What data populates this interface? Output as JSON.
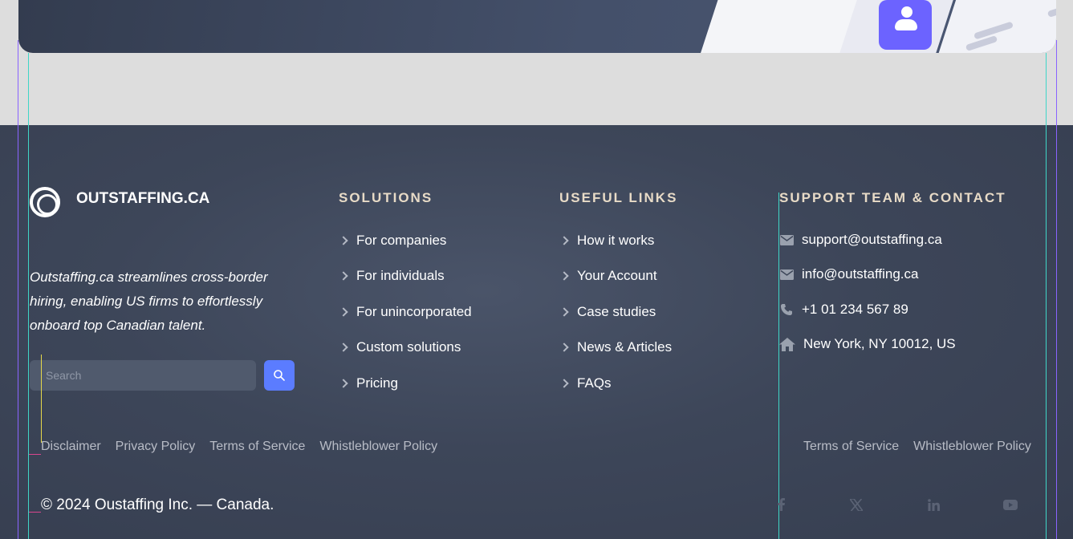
{
  "brand": {
    "name": "OUTSTAFFING.CA"
  },
  "tagline": "Outstaffing.ca streamlines cross-border hiring, enabling US firms to effortlessly onboard top Canadian talent.",
  "search": {
    "placeholder": "Search"
  },
  "solutions": {
    "title": "SOLUTIONS",
    "items": [
      "For companies",
      "For individuals",
      "For unincorporated",
      "Custom solutions",
      "Pricing"
    ]
  },
  "useful_links": {
    "title": "USEFUL LINKS",
    "items": [
      "How it works",
      "Your Account",
      "Case studies",
      "News & Articles",
      "FAQs"
    ]
  },
  "contact": {
    "title": "SUPPORT TEAM & CONTACT",
    "items": [
      {
        "icon": "envelope-icon",
        "text": "support@outstaffing.ca"
      },
      {
        "icon": "envelope-icon",
        "text": "info@outstaffing.ca"
      },
      {
        "icon": "phone-icon",
        "text": "+1 01 234 567 89"
      },
      {
        "icon": "home-icon",
        "text": "New York, NY 10012, US"
      }
    ]
  },
  "legal_left": [
    "Disclaimer",
    "Privacy Policy",
    "Terms of Service",
    "Whistleblower Policy"
  ],
  "legal_right": [
    "Terms of Service",
    "Whistleblower Policy"
  ],
  "copyright": "© 2024 Oustaffing Inc. — Canada.",
  "social": [
    "facebook-icon",
    "x-icon",
    "linkedin-icon",
    "youtube-icon"
  ],
  "colors": {
    "accent": "#5b7cff",
    "heading": "#e8dbc7",
    "footer_bg": "#3d4659"
  }
}
